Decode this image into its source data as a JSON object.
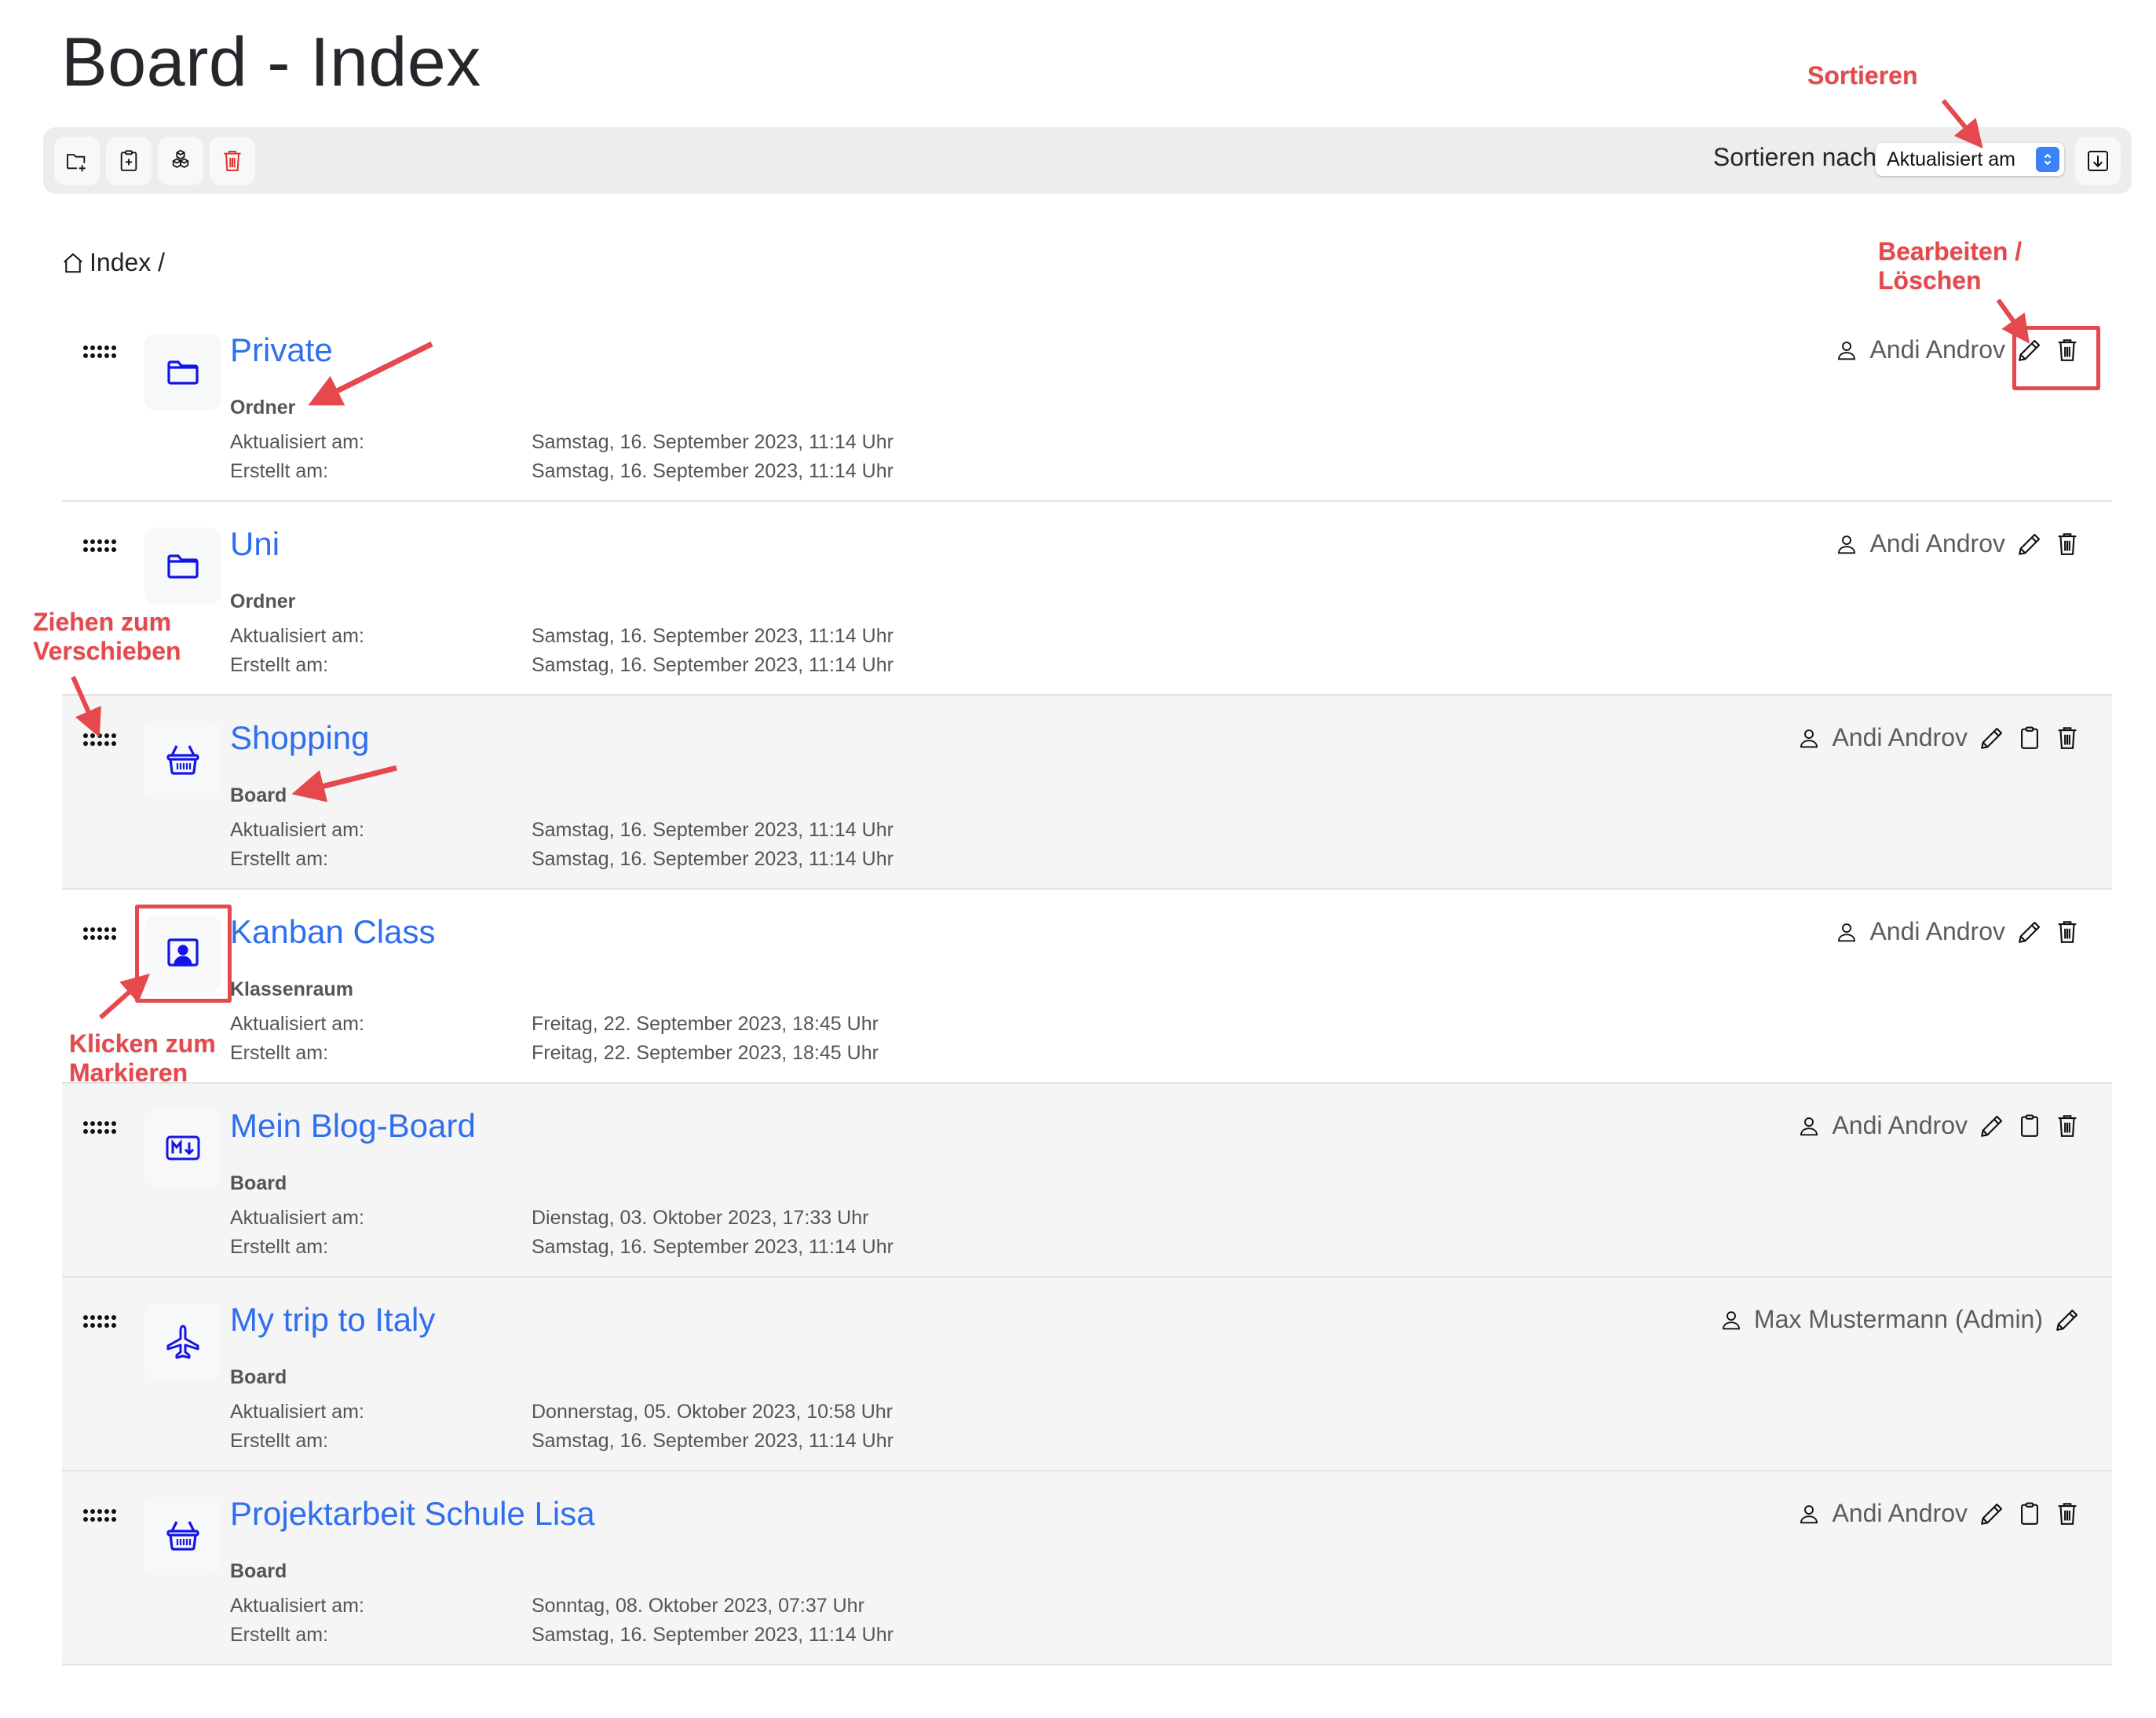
{
  "page": {
    "title": "Board - Index"
  },
  "toolbar": {
    "buttons": [
      {
        "icon": "folder-plus-icon",
        "label": "Neuer Ordner"
      },
      {
        "icon": "clipboard-plus-icon",
        "label": "Neues Board"
      },
      {
        "icon": "boxes-icon",
        "label": "Neuer Klassenraum"
      },
      {
        "icon": "trash-icon",
        "label": "Löschen"
      }
    ],
    "sort_label": "Sortieren nach",
    "sort_value": "Aktualisiert am",
    "sort_direction_icon": "arrow-down-icon"
  },
  "breadcrumb": {
    "icon": "home-icon",
    "label": "Index /"
  },
  "labels": {
    "updated": "Aktualisiert am:",
    "created": "Erstellt am:"
  },
  "items": [
    {
      "title": "Private",
      "type": "Ordner",
      "icon": "folder-icon",
      "updated": "Samstag, 16. September 2023, 11:14 Uhr",
      "created": "Samstag, 16. September 2023, 11:14 Uhr",
      "owner": "Andi Androv",
      "actions": [
        "edit",
        "delete"
      ],
      "kind": "folder"
    },
    {
      "title": "Uni",
      "type": "Ordner",
      "icon": "folder-icon",
      "updated": "Samstag, 16. September 2023, 11:14 Uhr",
      "created": "Samstag, 16. September 2023, 11:14 Uhr",
      "owner": "Andi Androv",
      "actions": [
        "edit",
        "delete"
      ],
      "kind": "folder"
    },
    {
      "title": "Shopping",
      "type": "Board",
      "icon": "basket-icon",
      "updated": "Samstag, 16. September 2023, 11:14 Uhr",
      "created": "Samstag, 16. September 2023, 11:14 Uhr",
      "owner": "Andi Androv",
      "actions": [
        "edit",
        "copy",
        "delete"
      ],
      "kind": "board"
    },
    {
      "title": "Kanban Class",
      "type": "Klassenraum",
      "icon": "classroom-icon",
      "updated": "Freitag, 22. September 2023, 18:45 Uhr",
      "created": "Freitag, 22. September 2023, 18:45 Uhr",
      "owner": "Andi Androv",
      "actions": [
        "edit",
        "delete"
      ],
      "kind": "classroom"
    },
    {
      "title": "Mein Blog-Board",
      "type": "Board",
      "icon": "markdown-icon",
      "updated": "Dienstag, 03. Oktober 2023, 17:33 Uhr",
      "created": "Samstag, 16. September 2023, 11:14 Uhr",
      "owner": "Andi Androv",
      "actions": [
        "edit",
        "copy",
        "delete"
      ],
      "kind": "board"
    },
    {
      "title": "My trip to Italy",
      "type": "Board",
      "icon": "airplane-icon",
      "updated": "Donnerstag, 05. Oktober 2023, 10:58 Uhr",
      "created": "Samstag, 16. September 2023, 11:14 Uhr",
      "owner": "Max Mustermann (Admin)",
      "actions": [
        "edit"
      ],
      "kind": "board"
    },
    {
      "title": "Projektarbeit Schule Lisa",
      "type": "Board",
      "icon": "basket-icon",
      "updated": "Sonntag, 08. Oktober 2023, 07:37 Uhr",
      "created": "Samstag, 16. September 2023, 11:14 Uhr",
      "owner": "Andi Androv",
      "actions": [
        "edit",
        "copy",
        "delete"
      ],
      "kind": "board"
    }
  ],
  "annotations": {
    "sort": "Sortieren",
    "edit_delete_1": "Bearbeiten /",
    "edit_delete_2": "Löschen",
    "drag_1": "Ziehen zum",
    "drag_2": "Verschieben",
    "select_1": "Klicken zum",
    "select_2": "Markieren"
  },
  "colors": {
    "link": "#2f6fed",
    "icon": "#1414e6",
    "annotation": "#e5484d",
    "danger": "#e0352b"
  }
}
